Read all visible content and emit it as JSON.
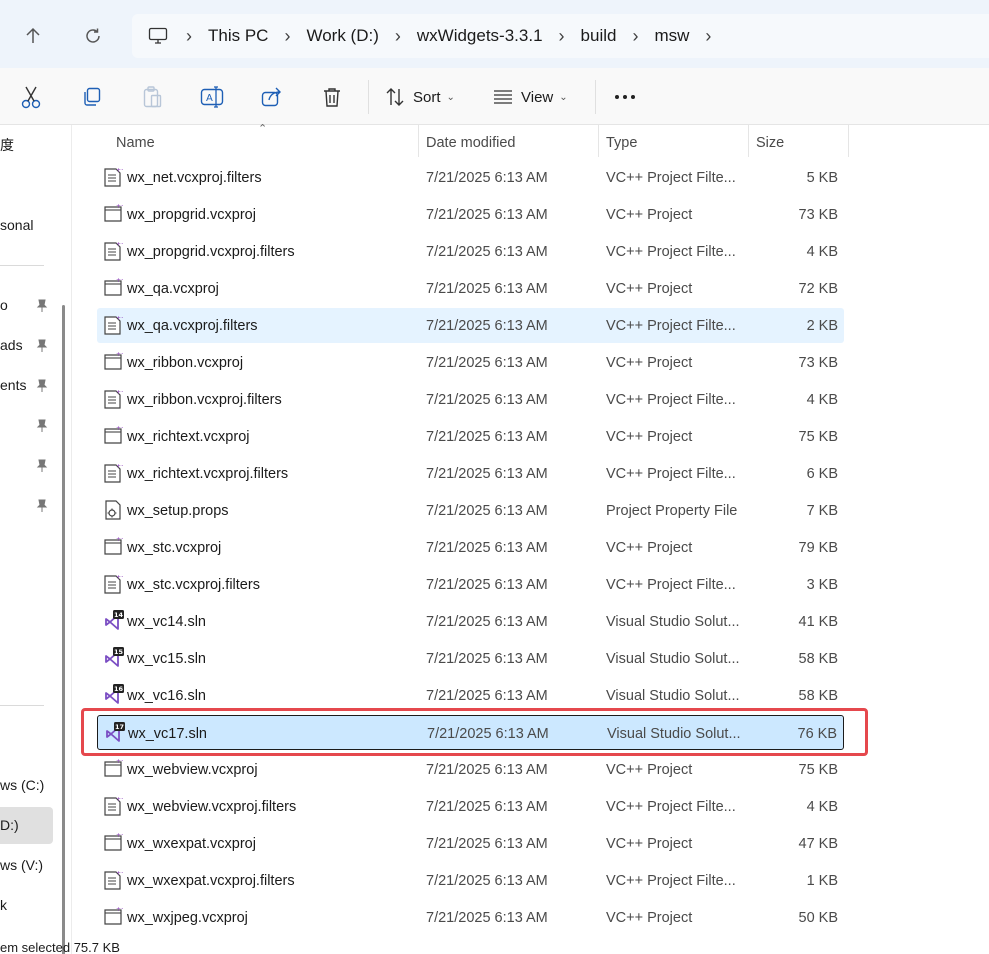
{
  "address": {
    "crumbs": [
      "This PC",
      "Work (D:)",
      "wxWidgets-3.3.1",
      "build",
      "msw"
    ]
  },
  "toolbar": {
    "sort_label": "Sort",
    "view_label": "View"
  },
  "sidebar": {
    "items": [
      "度",
      "sonal",
      "o",
      "ads",
      "ents",
      "ws (C:)",
      "D:)",
      "ws (V:)",
      "k"
    ]
  },
  "columns": {
    "name": "Name",
    "date": "Date modified",
    "type": "Type",
    "size": "Size"
  },
  "files": [
    {
      "name": "wx_net.vcxproj.filters",
      "date": "7/21/2025 6:13 AM",
      "type": "VC++ Project Filte...",
      "size": "5 KB",
      "icon": "filters-icon"
    },
    {
      "name": "wx_propgrid.vcxproj",
      "date": "7/21/2025 6:13 AM",
      "type": "VC++ Project",
      "size": "73 KB",
      "icon": "vcxproj-icon"
    },
    {
      "name": "wx_propgrid.vcxproj.filters",
      "date": "7/21/2025 6:13 AM",
      "type": "VC++ Project Filte...",
      "size": "4 KB",
      "icon": "filters-icon"
    },
    {
      "name": "wx_qa.vcxproj",
      "date": "7/21/2025 6:13 AM",
      "type": "VC++ Project",
      "size": "72 KB",
      "icon": "vcxproj-icon"
    },
    {
      "name": "wx_qa.vcxproj.filters",
      "date": "7/21/2025 6:13 AM",
      "type": "VC++ Project Filte...",
      "size": "2 KB",
      "icon": "filters-icon"
    },
    {
      "name": "wx_ribbon.vcxproj",
      "date": "7/21/2025 6:13 AM",
      "type": "VC++ Project",
      "size": "73 KB",
      "icon": "vcxproj-icon"
    },
    {
      "name": "wx_ribbon.vcxproj.filters",
      "date": "7/21/2025 6:13 AM",
      "type": "VC++ Project Filte...",
      "size": "4 KB",
      "icon": "filters-icon"
    },
    {
      "name": "wx_richtext.vcxproj",
      "date": "7/21/2025 6:13 AM",
      "type": "VC++ Project",
      "size": "75 KB",
      "icon": "vcxproj-icon"
    },
    {
      "name": "wx_richtext.vcxproj.filters",
      "date": "7/21/2025 6:13 AM",
      "type": "VC++ Project Filte...",
      "size": "6 KB",
      "icon": "filters-icon"
    },
    {
      "name": "wx_setup.props",
      "date": "7/21/2025 6:13 AM",
      "type": "Project Property File",
      "size": "7 KB",
      "icon": "props-icon"
    },
    {
      "name": "wx_stc.vcxproj",
      "date": "7/21/2025 6:13 AM",
      "type": "VC++ Project",
      "size": "79 KB",
      "icon": "vcxproj-icon"
    },
    {
      "name": "wx_stc.vcxproj.filters",
      "date": "7/21/2025 6:13 AM",
      "type": "VC++ Project Filte...",
      "size": "3 KB",
      "icon": "filters-icon"
    },
    {
      "name": "wx_vc14.sln",
      "date": "7/21/2025 6:13 AM",
      "type": "Visual Studio Solut...",
      "size": "41 KB",
      "icon": "sln-icon",
      "badge": "14"
    },
    {
      "name": "wx_vc15.sln",
      "date": "7/21/2025 6:13 AM",
      "type": "Visual Studio Solut...",
      "size": "58 KB",
      "icon": "sln-icon",
      "badge": "15"
    },
    {
      "name": "wx_vc16.sln",
      "date": "7/21/2025 6:13 AM",
      "type": "Visual Studio Solut...",
      "size": "58 KB",
      "icon": "sln-icon",
      "badge": "16"
    },
    {
      "name": "wx_vc17.sln",
      "date": "7/21/2025 6:13 AM",
      "type": "Visual Studio Solut...",
      "size": "76 KB",
      "icon": "sln-icon",
      "badge": "17"
    },
    {
      "name": "wx_webview.vcxproj",
      "date": "7/21/2025 6:13 AM",
      "type": "VC++ Project",
      "size": "75 KB",
      "icon": "vcxproj-icon"
    },
    {
      "name": "wx_webview.vcxproj.filters",
      "date": "7/21/2025 6:13 AM",
      "type": "VC++ Project Filte...",
      "size": "4 KB",
      "icon": "filters-icon"
    },
    {
      "name": "wx_wxexpat.vcxproj",
      "date": "7/21/2025 6:13 AM",
      "type": "VC++ Project",
      "size": "47 KB",
      "icon": "vcxproj-icon"
    },
    {
      "name": "wx_wxexpat.vcxproj.filters",
      "date": "7/21/2025 6:13 AM",
      "type": "VC++ Project Filte...",
      "size": "1 KB",
      "icon": "filters-icon"
    },
    {
      "name": "wx_wxjpeg.vcxproj",
      "date": "7/21/2025 6:13 AM",
      "type": "VC++ Project",
      "size": "50 KB",
      "icon": "vcxproj-icon"
    }
  ],
  "status_bar": {
    "text": "em selected  75.7 KB"
  },
  "colors": {
    "accent_highlight": "#e5484d",
    "selection_bg": "#cce8ff",
    "hover_bg": "#e5f3ff",
    "vs_purple": "#7b4ec3"
  }
}
